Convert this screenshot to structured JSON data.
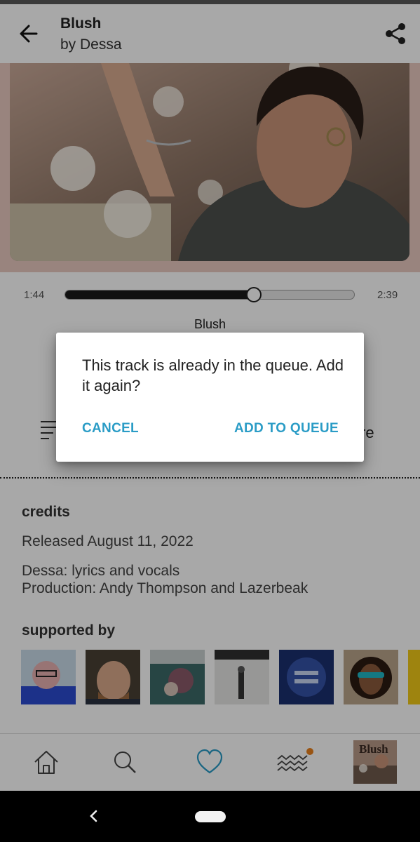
{
  "header": {
    "title": "Blush",
    "subtitle": "by Dessa",
    "back_icon": "arrow-left-icon",
    "share_icon": "share-icon"
  },
  "player": {
    "current_time": "1:44",
    "total_time": "2:39",
    "progress_fraction": 0.654,
    "track_title": "Blush",
    "share_label_partial": "re"
  },
  "credits": {
    "heading": "credits",
    "released": "Released August 11, 2022",
    "line1": "Dessa: lyrics and vocals",
    "line2": "Production: Andy Thompson and Lazerbeak"
  },
  "supported_by": {
    "heading": "supported by",
    "avatar_tiles": [
      "supporter-1",
      "supporter-2",
      "supporter-3",
      "supporter-4",
      "supporter-5",
      "supporter-6",
      "supporter-7"
    ]
  },
  "dialog": {
    "message": "This track is already in the queue. Add it again?",
    "cancel_label": "CANCEL",
    "confirm_label": "ADD TO QUEUE"
  },
  "nav": {
    "items": [
      "home-icon",
      "search-icon",
      "heart-icon",
      "feed-icon",
      "now-playing-thumbnail"
    ],
    "active": "heart-icon",
    "feed_has_badge": true
  },
  "colors": {
    "accent": "#2a9cc6",
    "badge": "#e8801c",
    "scrim": "rgba(0,0,0,0.34)"
  }
}
